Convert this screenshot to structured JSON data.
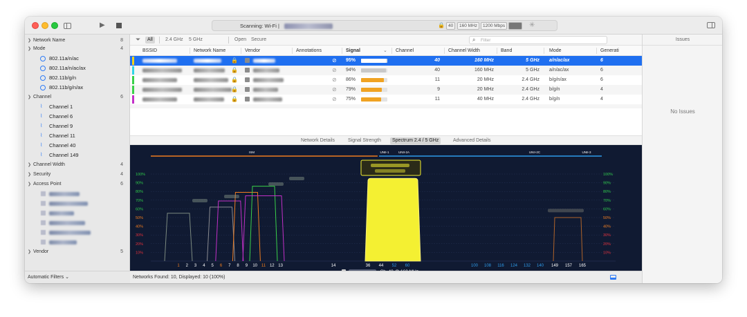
{
  "titlebar": {
    "scan_label": "Scanning: Wi-Fi |",
    "pills": {
      "channel": "40",
      "width": "160 MHz",
      "rate": "1200 Mbps"
    }
  },
  "sidebar": {
    "groups": {
      "network_name": {
        "label": "Network Name",
        "count": "8"
      },
      "mode": {
        "label": "Mode",
        "count": "4"
      },
      "channel": {
        "label": "Channel",
        "count": "6"
      },
      "channel_width": {
        "label": "Channel Width",
        "count": "4"
      },
      "security": {
        "label": "Security",
        "count": "4"
      },
      "access_point": {
        "label": "Access Point",
        "count": "6"
      },
      "vendor": {
        "label": "Vendor",
        "count": "5"
      }
    },
    "modes": [
      "802.11a/n/ac",
      "802.11a/n/ac/ax",
      "802.11b/g/n",
      "802.11b/g/n/ax"
    ],
    "channels": [
      "Channel 1",
      "Channel 6",
      "Channel 9",
      "Channel 11",
      "Channel 40",
      "Channel 149"
    ],
    "footer": "Automatic Filters"
  },
  "filters": {
    "all": "All",
    "ghz24": "2.4 GHz",
    "ghz5": "5 GHz",
    "open": "Open",
    "secure": "Secure",
    "search_placeholder": "Filter"
  },
  "table": {
    "columns": {
      "bssid": "BSSID",
      "network_name": "Network Name",
      "vendor": "Vendor",
      "annotations": "Annotations",
      "signal": "Signal",
      "channel": "Channel",
      "channel_width": "Channel Width",
      "band": "Band",
      "mode": "Mode",
      "generation": "Generati"
    },
    "rows": [
      {
        "color": "#f2d41c",
        "signal": "95%",
        "signal_pct": 95,
        "bar": "#ffffff",
        "channel": "40",
        "width": "160 MHz",
        "band": "5 GHz",
        "mode": "a/n/ac/ax",
        "gen": "6"
      },
      {
        "color": "#2fd4e6",
        "signal": "94%",
        "signal_pct": 94,
        "bar": "#c8c8c8",
        "channel": "40",
        "width": "160 MHz",
        "band": "5 GHz",
        "mode": "a/n/ac/ax",
        "gen": "6"
      },
      {
        "color": "#3ad14a",
        "signal": "86%",
        "signal_pct": 86,
        "bar": "#f0a323",
        "channel": "11",
        "width": "20 MHz",
        "band": "2.4 GHz",
        "mode": "b/g/n/ax",
        "gen": "6"
      },
      {
        "color": "#3ad14a",
        "signal": "79%",
        "signal_pct": 79,
        "bar": "#f0a323",
        "channel": "9",
        "width": "20 MHz",
        "band": "2.4 GHz",
        "mode": "b/g/n",
        "gen": "4"
      },
      {
        "color": "#c330c8",
        "signal": "75%",
        "signal_pct": 75,
        "bar": "#f0a323",
        "channel": "11",
        "width": "40 MHz",
        "band": "2.4 GHz",
        "mode": "b/g/n",
        "gen": "4"
      }
    ]
  },
  "view_tabs": {
    "network_details": "Network Details",
    "signal_strength": "Signal Strength",
    "spectrum": "Spectrum 2.4 / 5 GHz",
    "advanced": "Advanced Details"
  },
  "spectrum": {
    "band_labels": {
      "ism": "ISM",
      "unii1": "UNII-1",
      "unii2a": "UNII-2A",
      "unii2c": "UNII-2C",
      "unii3": "UNII-3"
    },
    "y_ticks": [
      "100%",
      "90%",
      "80%",
      "70%",
      "60%",
      "50%",
      "40%",
      "30%",
      "20%",
      "10%"
    ],
    "ch24": [
      "1",
      "2",
      "3",
      "4",
      "5",
      "6",
      "7",
      "8",
      "9",
      "10",
      "11",
      "12",
      "13",
      "14"
    ],
    "ch5": [
      "36",
      "44",
      "52",
      "60",
      "100",
      "108",
      "116",
      "124",
      "132",
      "140",
      "149",
      "157",
      "165"
    ],
    "selected_label": ", Ch. 40 @ 160 MHz",
    "colors": {
      "yellow": "#f4f032",
      "orange": "#ef7c1f",
      "blue": "#2e9bea",
      "red": "#e5313b",
      "green": "#2fc94a"
    }
  },
  "status": {
    "networks": "Networks Found: 10, Displayed: 10 (100%)"
  },
  "issues": {
    "header": "Issues",
    "empty": "No Issues"
  }
}
